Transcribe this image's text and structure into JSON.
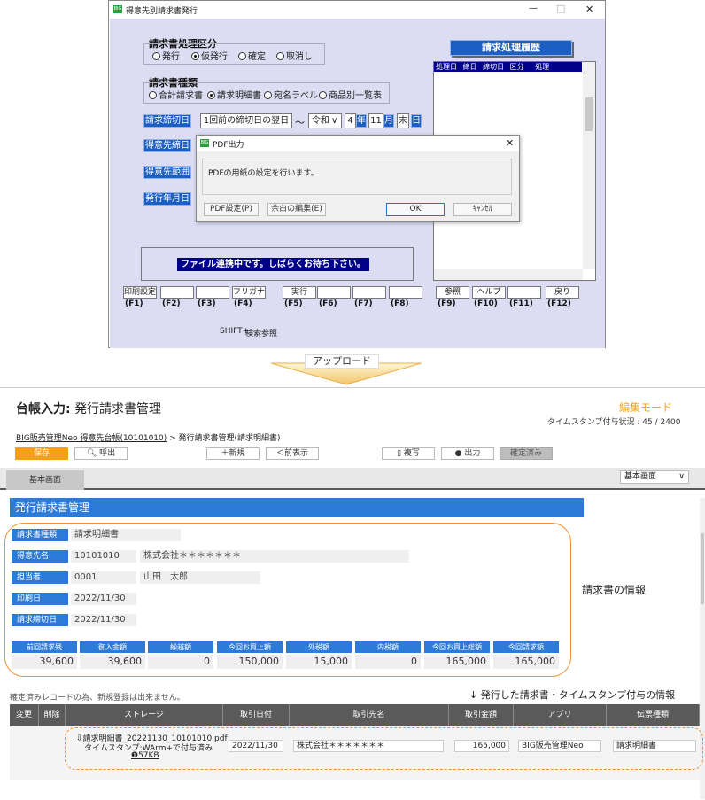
{
  "legacy": {
    "title": "得意先別請求書発行",
    "app_icon": "BIG",
    "controls": {
      "minimize": "—",
      "maximize": "□",
      "close": "✕"
    },
    "section1": {
      "label": "請求書処理区分",
      "options": [
        "発行",
        "仮発行",
        "確定",
        "取消し"
      ],
      "selected": 1
    },
    "section2": {
      "label": "請求書種類",
      "options": [
        "合計請求書",
        "請求明細書",
        "宛名ラベル",
        "商品別一覧表"
      ],
      "selected": 1
    },
    "history": {
      "title": "請求処理履歴",
      "columns": [
        "処理日",
        "締日",
        "締切日",
        "区分",
        "処理"
      ]
    },
    "side_buttons": [
      "請求締切日",
      "得意先締日",
      "得意先範囲",
      "発行年月日"
    ],
    "closing": {
      "select": "1回前の締切日の翌日",
      "tilde": "〜",
      "era": "令和",
      "year": "4",
      "year_unit": "年",
      "month": "11",
      "month_unit": "月",
      "day": "末",
      "day_unit": "日"
    },
    "status": "ファイル連携中です。しばらくお待ち下さい。",
    "fkeys": [
      "印刷設定",
      "",
      "",
      "フリガナ",
      "実行",
      "",
      "",
      "",
      "参照",
      "ヘルプ",
      "",
      "戻り"
    ],
    "flabels": [
      "(F1)",
      "(F2)",
      "(F3)",
      "(F4)",
      "(F5)",
      "(F6)",
      "(F7)",
      "(F8)",
      "(F9)",
      "(F10)",
      "(F11)",
      "(F12)"
    ],
    "shift_label": "SHIFT+",
    "search_label": "検索参照",
    "dialog": {
      "title": "PDF出力",
      "message": "PDFの用紙の設定を行います。",
      "btn_pdf": "PDF設定(P)",
      "btn_margin": "余白の編集(E)",
      "btn_ok": "OK",
      "btn_cancel": "ｷｬﾝｾﾙ"
    }
  },
  "upload_label": "アップロード",
  "app": {
    "title_prefix": "台帳入力:",
    "title": "発行請求書管理",
    "mode": "編集モード",
    "timestamp_status": "タイムスタンプ付与状況 : 45 / 2400",
    "breadcrumb_link": "BIG販売管理Neo 得意先台帳(10101010)",
    "breadcrumb_rest": " > 発行請求書管理(請求明細書)",
    "toolbar": {
      "save": "保存",
      "call": "呼出",
      "new": "新規",
      "prev": "前表示",
      "copy": "複写",
      "output": "出力",
      "confirmed": "確定済み"
    },
    "tab": "基本画面",
    "view_select": "基本画面",
    "section_title": "発行請求書管理",
    "fields": {
      "type_label": "請求書種類",
      "type_value": "請求明細書",
      "customer_label": "得意先名",
      "customer_code": "10101010",
      "customer_name": "株式会社＊＊＊＊＊＊＊",
      "staff_label": "担当者",
      "staff_code": "0001",
      "staff_name": "山田　太郎",
      "print_label": "印刷日",
      "print_value": "2022/11/30",
      "closing_label": "請求締切日",
      "closing_value": "2022/11/30"
    },
    "amounts": {
      "headers": [
        "前回請求残",
        "御入金額",
        "繰越額",
        "今回お買上額",
        "外税額",
        "内税額",
        "今回お買上総額",
        "今回請求額"
      ],
      "values": [
        "39,600",
        "39,600",
        "0",
        "150,000",
        "15,000",
        "0",
        "165,000",
        "165,000"
      ]
    },
    "annotation_invoice": "請求書の情報",
    "notice": "確定済みレコードの為、新規登録は出来ません。",
    "annotation_timestamp": "↓ 発行した請求書・タイムスタンプ付与の情報",
    "table": {
      "headers": [
        "変更",
        "削除",
        "ストレージ",
        "取引日付",
        "取引先名",
        "取引金額",
        "アプリ",
        "伝票種類"
      ],
      "row": {
        "file": "請求明細書_20221130_10101010.pdf",
        "timestamp": "タイムスタンプ:WArm+で付与済み",
        "size": "57KB",
        "date": "2022/11/30",
        "partner": "株式会社＊＊＊＊＊＊＊",
        "amount": "165,000",
        "app": "BIG販売管理Neo",
        "slip": "請求明細書"
      }
    }
  },
  "colors": {
    "blue": "#2d7bd8",
    "orange": "#f5a01a",
    "legacy_bg": "#dcdcf2",
    "dark_blue": "#00008b"
  }
}
